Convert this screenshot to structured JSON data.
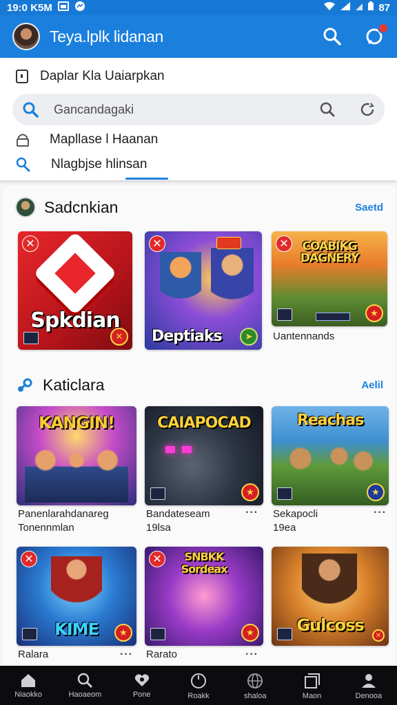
{
  "status_bar": {
    "time": "19:0 K5M",
    "battery": "87"
  },
  "app_bar": {
    "title": "Teya.lplk lidanan"
  },
  "panel": {
    "row1_label": "Daplar Kla Uaiarpkan",
    "search_placeholder": "Gancandagaki",
    "row3_label": "Mapllase l Haanan",
    "row4_label": "Nlagbjse hlinsan"
  },
  "section1": {
    "title": "Sadcnkian",
    "link": "Saetd",
    "cards": [
      {
        "art_title": "Spkdian",
        "label": ""
      },
      {
        "art_title": "Deptiaks",
        "label": ""
      },
      {
        "art_title": "COABIKG DAGNERY",
        "label": "Uantennands"
      }
    ]
  },
  "section2": {
    "title": "Katiclara",
    "link": "Aelil",
    "cards": [
      {
        "art_title": "KANGIN!",
        "label": "Panenlarahdanareg",
        "sub": "Tonennmlan"
      },
      {
        "art_title": "CAIAPOCAD",
        "label": "Bandateseam",
        "sub": "19lsa"
      },
      {
        "art_title": "Reachas",
        "label": "Sekapocli",
        "sub": "19ea"
      },
      {
        "art_title": "KIME",
        "label": "Ralara",
        "sub": ""
      },
      {
        "art_title": "SNBKK Sordeax",
        "label": "Rarato",
        "sub": ""
      },
      {
        "art_title": "Gulcoss",
        "label": "",
        "sub": ""
      }
    ]
  },
  "bottom_nav": {
    "items": [
      {
        "label": "Niaokko",
        "icon": "home-icon"
      },
      {
        "label": "Haoaeom",
        "icon": "search-icon"
      },
      {
        "label": "Pone",
        "icon": "heart-icon"
      },
      {
        "label": "Roakk",
        "icon": "circle-icon"
      },
      {
        "label": "shaloa",
        "icon": "globe-icon"
      },
      {
        "label": "Maon",
        "icon": "stack-icon"
      },
      {
        "label": "Denooa",
        "icon": "profile-icon"
      }
    ]
  },
  "colors": {
    "primary": "#1a7fdd",
    "badge": "#e12a2a",
    "nav_bg": "#0c0c0e"
  }
}
